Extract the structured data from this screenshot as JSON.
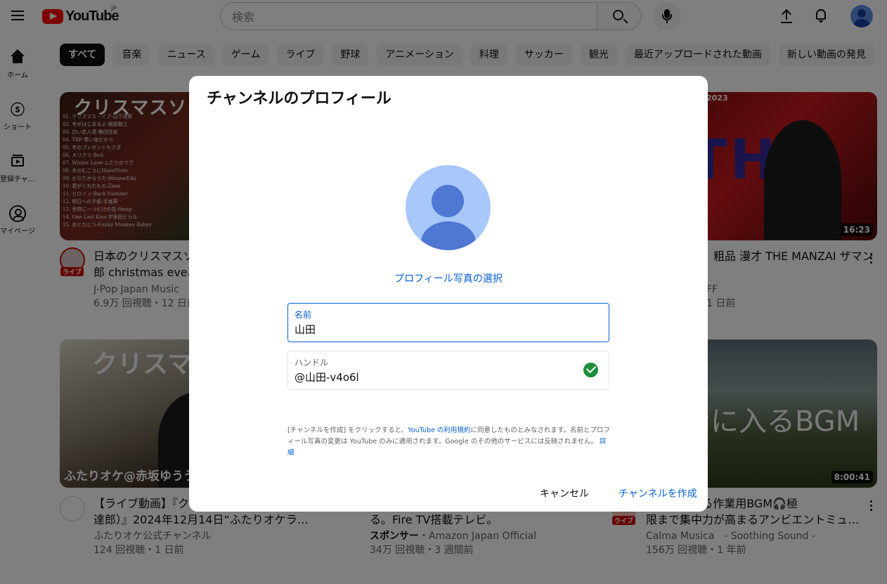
{
  "header": {
    "logo_text": "YouTube",
    "region": "JP",
    "search_placeholder": "検索"
  },
  "sidebar": {
    "items": [
      {
        "label": "ホーム"
      },
      {
        "label": "ショート"
      },
      {
        "label": "登録チャンネル"
      },
      {
        "label": "マイページ"
      }
    ]
  },
  "chips": [
    "すべて",
    "音楽",
    "ニュース",
    "ゲーム",
    "ライブ",
    "野球",
    "アニメーション",
    "料理",
    "サッカー",
    "観光",
    "最近アップロードされた動画",
    "新しい動画の発見"
  ],
  "videos": [
    {
      "thumb_title": "クリスマスソン",
      "thumb_list": "01. クリスマス・イブ-山下達郎\n02. 冬がはじまるよ-槇原敬之\n03. 白い恋人達-桑田佳祐\n04. TRF-寒い夜だから\n05. 冬のプレゼントもさぎ\n06. メリクリ BoA\n07. Winter Love-ふたりのラヴ\n08. 冬のむこうにHazelNuts\n09. かなたからうた-Mannaのiki\n10. 君がくれたもの-Zone\n11. ヒロイン-Back Number\n12. 明日への手紙-手嶌葵\n13. 世界に一つだけの花-Smap\n14. One Last Kiss-宇多田ヒカル\n15. あとひとつ-Funky Monkey Babys",
      "title": "日本のクリスマスソ",
      "title2": "郎 christmas eve、",
      "channel": "J-Pop Japan Music",
      "meta": "6.9万 回視聴・12 日前",
      "live": "ライブ"
    },
    {
      "thumb_year": "2023",
      "duration": "16:23",
      "title": "粗品 漫才 THE MANZAI ザマン",
      "channel": "FF",
      "meta": "1 日前"
    },
    {
      "thumb_title": "クリスマ",
      "thumb_sub": "ふたりオケ@赤坂ゆうう",
      "title": "【ライブ動画】『ク",
      "title2": "達郎）』2024年12月14日“ふたりオケラ…",
      "channel": "ふたりオケ公式チャンネル",
      "meta": "124 回視聴・1 日前"
    },
    {
      "title": "る。Fire TV搭載テレビ。",
      "sponsor": "スポンサー",
      "channel": "・Amazon Japan Official",
      "meta": "34万 回視聴・3 週間前"
    },
    {
      "thumb_title": "ンに入るBGM",
      "duration": "8:00:41",
      "title": "ゾーンに入る作業用BGM🎧極",
      "title2": "限まで集中力が高まるアンビエントミュ…",
      "channel": "Calma Musica　- Soothing Sound -",
      "meta": "156万 回視聴・1 年前",
      "live": "ライブ"
    }
  ],
  "dialog": {
    "title": "チャンネルのプロフィール",
    "pick_photo": "プロフィール写真の選択",
    "name_label": "名前",
    "name_value": "山田",
    "handle_label": "ハンドル",
    "handle_value": "@山田-v4o6l",
    "legal_1": "[チャンネルを作成] をクリックすると、",
    "legal_link1": "YouTube の利用規約",
    "legal_2": "に同意したものとみなされます。名前とプロフィール写真の変更は YouTube のみに適用されます。Google のその他のサービスには反映されません。",
    "legal_link2": "詳細",
    "cancel": "キャンセル",
    "create": "チャンネルを作成"
  },
  "colors": {
    "accent": "#065fd4",
    "brand_red": "#ff0000",
    "success": "#1e8e3e",
    "avatar_bg": "#a8c7fa"
  }
}
